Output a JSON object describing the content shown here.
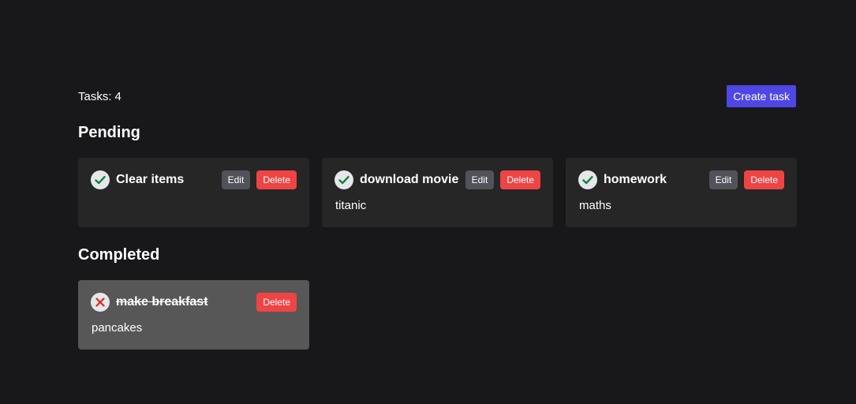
{
  "header": {
    "tasks_label": "Tasks:",
    "tasks_count": "4",
    "create_label": "Create task"
  },
  "sections": {
    "pending_title": "Pending",
    "completed_title": "Completed"
  },
  "pending": [
    {
      "title": "Clear items",
      "description": "",
      "edit_label": "Edit",
      "delete_label": "Delete",
      "status_icon": "check-icon"
    },
    {
      "title": "download movie",
      "description": "titanic",
      "edit_label": "Edit",
      "delete_label": "Delete",
      "status_icon": "check-icon"
    },
    {
      "title": "homework",
      "description": "maths",
      "edit_label": "Edit",
      "delete_label": "Delete",
      "status_icon": "check-icon"
    }
  ],
  "completed": [
    {
      "title": "make breakfast",
      "description": "pancakes",
      "delete_label": "Delete",
      "status_icon": "x-icon"
    }
  ],
  "colors": {
    "background": "#18181b",
    "card": "#262626",
    "card_completed": "#575757",
    "accent": "#4f46e5",
    "delete": "#ef4444",
    "edit": "#52525b",
    "check": "#15803d",
    "cross": "#dc2626"
  }
}
